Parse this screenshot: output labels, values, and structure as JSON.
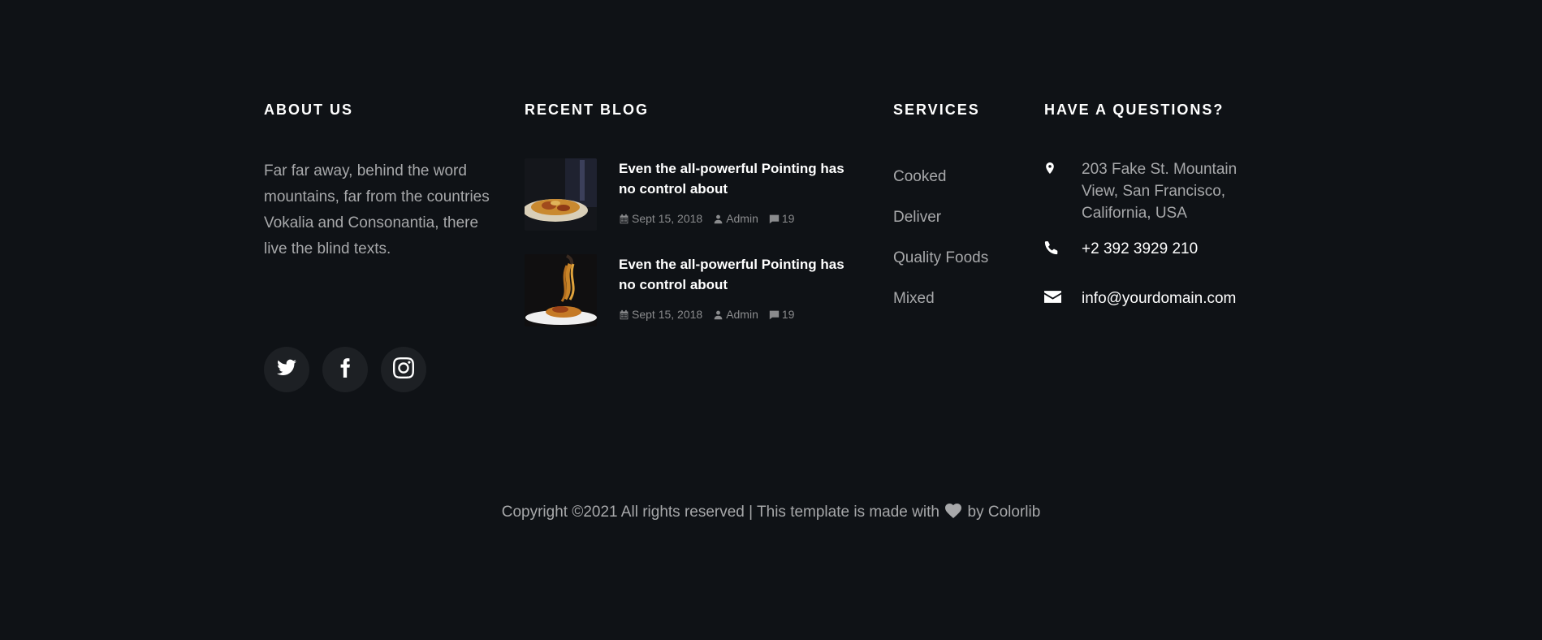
{
  "about": {
    "heading": "ABOUT US",
    "text": "Far far away, behind the word mountains, far from the countries Vokalia and Consonantia, there live the blind texts.",
    "socials": [
      {
        "icon": "twitter-icon"
      },
      {
        "icon": "facebook-icon"
      },
      {
        "icon": "instagram-icon"
      }
    ]
  },
  "blog": {
    "heading": "RECENT BLOG",
    "posts": [
      {
        "title": "Even the all-powerful Pointing has no control about",
        "date": "Sept 15, 2018",
        "author": "Admin",
        "comments": "19"
      },
      {
        "title": "Even the all-powerful Pointing has no control about",
        "date": "Sept 15, 2018",
        "author": "Admin",
        "comments": "19"
      }
    ]
  },
  "services": {
    "heading": "SERVICES",
    "items": [
      "Cooked",
      "Deliver",
      "Quality Foods",
      "Mixed"
    ]
  },
  "contact": {
    "heading": "HAVE A QUESTIONS?",
    "address": "203 Fake St. Mountain View, San Francisco, California, USA",
    "phone": "+2 392 3929 210",
    "email": "info@yourdomain.com"
  },
  "copyright": {
    "prefix": "Copyright ©2021 All rights reserved | This template is made with",
    "by": "by",
    "brand": "Colorlib"
  },
  "colors": {
    "background": "#0f1216",
    "text": "#a7a8aa",
    "heading": "#ffffff",
    "social_bg": "#1d2024"
  }
}
